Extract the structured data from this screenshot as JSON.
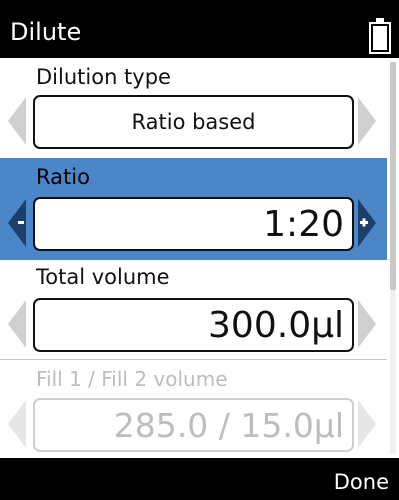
{
  "header": {
    "title": "Dilute"
  },
  "fields": {
    "dilution_type": {
      "label": "Dilution type",
      "value": "Ratio based"
    },
    "ratio": {
      "label": "Ratio",
      "value": "1:20",
      "decrease_symbol": "-",
      "increase_symbol": "+"
    },
    "total_volume": {
      "label": "Total volume",
      "value": "300.0µl"
    },
    "fill_volume": {
      "label": "Fill 1 / Fill 2 volume",
      "value": "285.0 / 15.0µl"
    }
  },
  "footer": {
    "done_label": "Done"
  },
  "colors": {
    "selected_row": "#4a86c8",
    "bar_background": "#000000",
    "disabled_text": "#bdbdbd",
    "arrow_light": "#d0d0d0"
  },
  "icons": [
    "battery-icon",
    "arrow-left-icon",
    "arrow-right-icon",
    "minus-icon",
    "plus-icon"
  ]
}
